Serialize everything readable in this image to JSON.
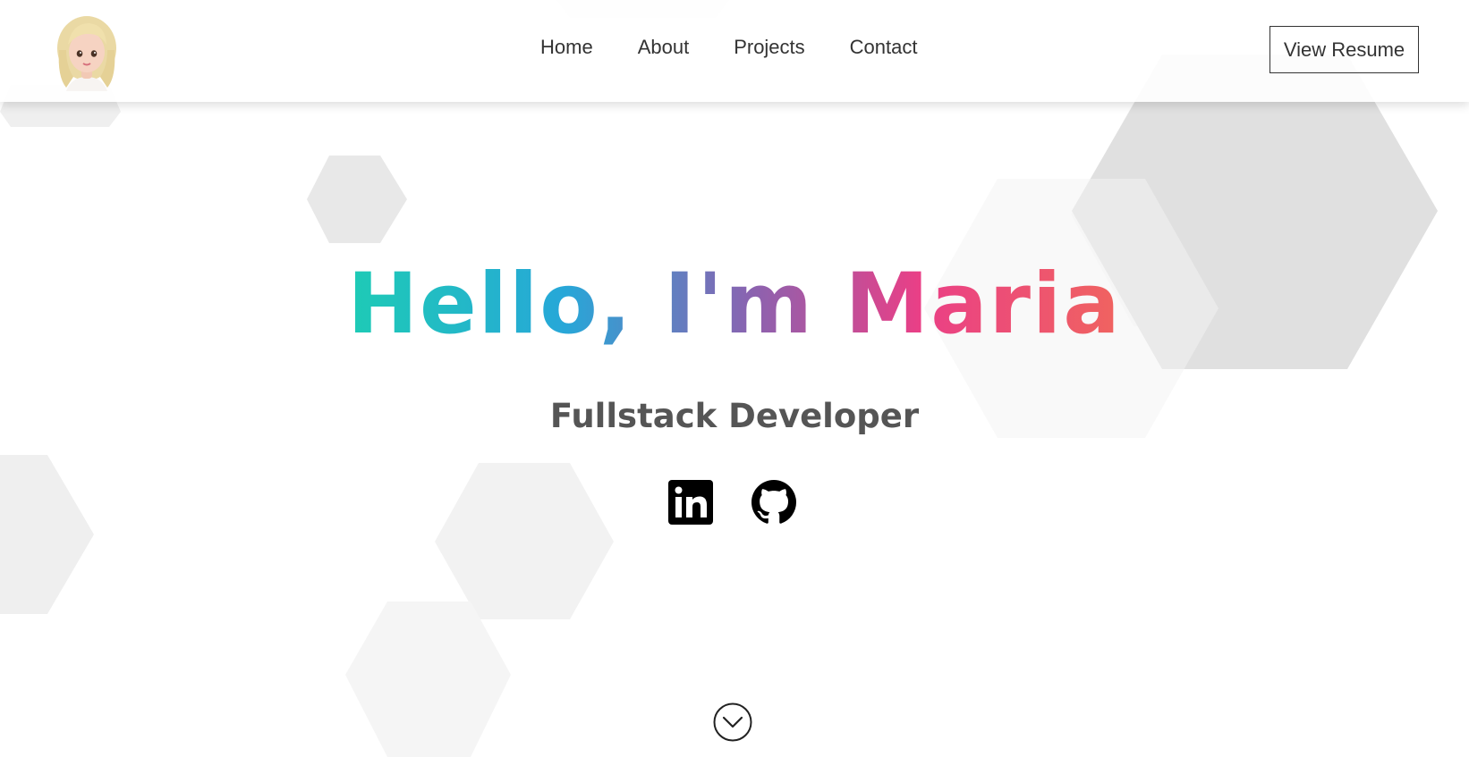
{
  "header": {
    "avatar_alt": "avatar",
    "nav": [
      {
        "label": "Home"
      },
      {
        "label": "About"
      },
      {
        "label": "Projects"
      },
      {
        "label": "Contact"
      }
    ],
    "resume_label": "View Resume"
  },
  "hero": {
    "title": "Hello, I'm Maria",
    "subtitle": "Fullstack Developer"
  },
  "social": {
    "linkedin_icon": "linkedin-icon",
    "github_icon": "github-icon"
  },
  "scroll_icon": "chevron-down-icon",
  "colors": {
    "gradient_start": "#1ecbb5",
    "gradient_mid": "#8a63b0",
    "gradient_end": "#f0645f",
    "text": "#333333",
    "subtitle": "#555555"
  }
}
